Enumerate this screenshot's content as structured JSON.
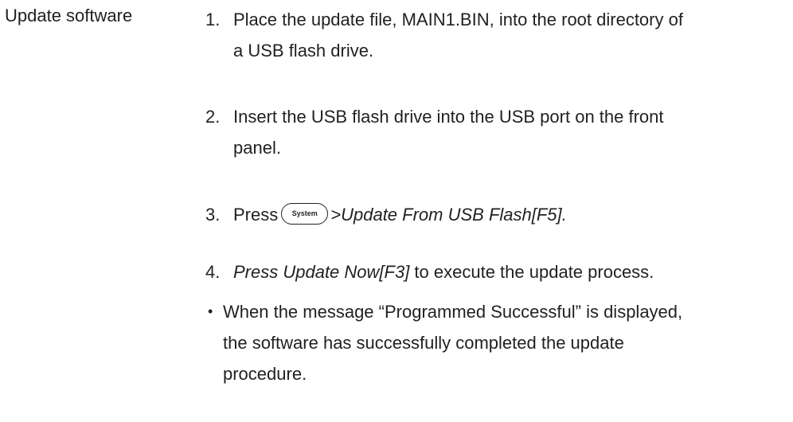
{
  "section": {
    "label": "Update software"
  },
  "steps": [
    {
      "number": "1.",
      "lines": [
        "Place the update file, MAIN1.BIN, into the root directory of",
        "a USB flash drive."
      ]
    },
    {
      "number": "2.",
      "lines": [
        "Insert the USB flash drive into the USB port on the front",
        "panel."
      ]
    },
    {
      "number": "3.",
      "prefix": "Press",
      "key_label": "System",
      "suffix": ">Update From USB Flash[F5]."
    },
    {
      "number": "4.",
      "italic": "Press Update Now[F3]",
      "rest": " to execute the update process."
    }
  ],
  "note": {
    "bullet": "•",
    "lines": [
      "When the message “Programmed Successful” is displayed,",
      "the software has successfully completed the update",
      "procedure."
    ]
  }
}
